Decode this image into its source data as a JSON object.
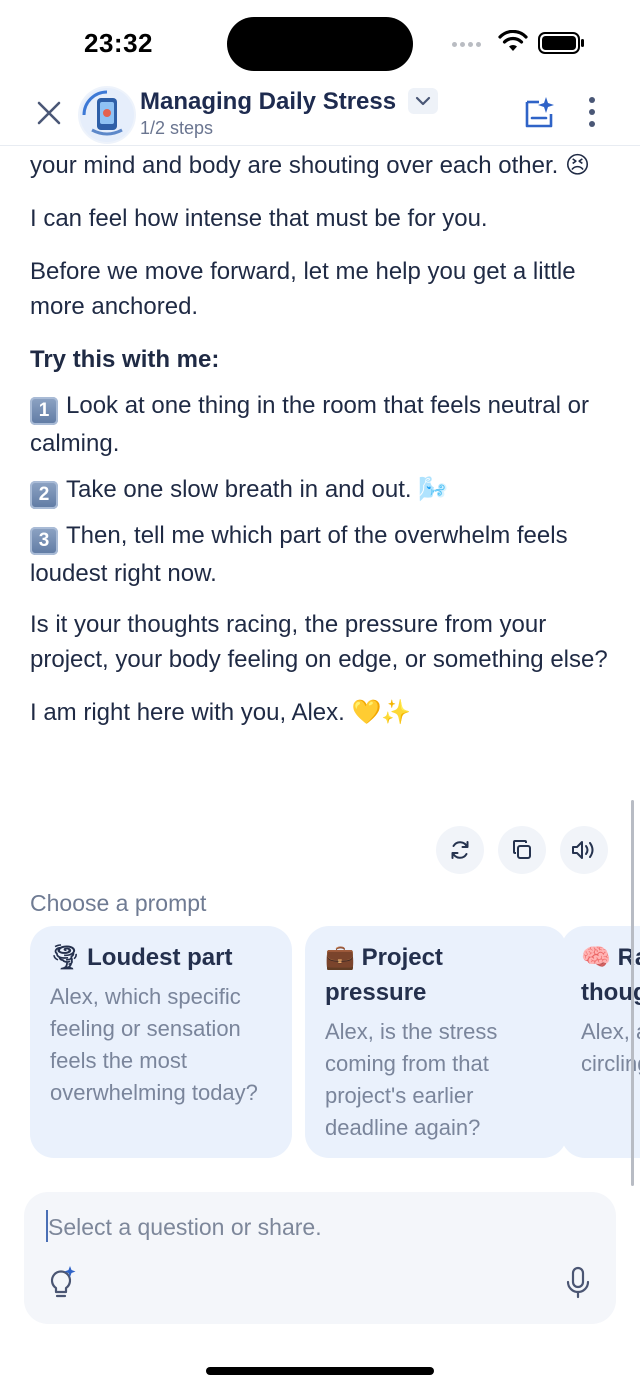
{
  "status_bar": {
    "time": "23:32"
  },
  "header": {
    "title": "Managing Daily Stress",
    "subtitle": "1/2 steps",
    "icons": [
      "close-icon",
      "chevron-down-icon",
      "notes-sparkle-icon",
      "more-vertical-icon"
    ]
  },
  "message": {
    "line_top": "your mind and body are shouting over each other. 😣",
    "p1": "I can feel how intense that must be for you.",
    "p2": "Before we move forward, let me help you get a little more anchored.",
    "heading": "Try this with me:",
    "steps": [
      {
        "num": "1",
        "text": "Look at one thing in the room that feels neutral or calming."
      },
      {
        "num": "2",
        "text": "Take one slow breath in and out. 🌬️"
      },
      {
        "num": "3",
        "text": "Then, tell me which part of the overwhelm feels loudest right now."
      }
    ],
    "p3": "Is it your thoughts racing, the pressure from your project, your body feeling on edge, or something else?",
    "p4": "I am right here with you, Alex. 💛✨"
  },
  "message_actions": [
    "regenerate-icon",
    "copy-icon",
    "speaker-icon"
  ],
  "prompts": {
    "label": "Choose a prompt",
    "cards": [
      {
        "emoji": "🌪",
        "title": "Loudest part",
        "body": "Alex, which specific feeling or sensation feels the most overwhelming today?"
      },
      {
        "emoji": "💼",
        "title": "Project pressure",
        "body": "Alex, is the stress coming from that project's earlier deadline again?"
      },
      {
        "emoji": "🧠",
        "title": "Racing thoughts",
        "body": "Alex, are the thoughts circling in your mind"
      }
    ]
  },
  "composer": {
    "placeholder": "Select a question or share.",
    "value": ""
  },
  "colors": {
    "accent": "#4a6fb5",
    "card_bg": "#eaf1fc",
    "text": "#1f2a44",
    "muted": "#7a859b"
  }
}
